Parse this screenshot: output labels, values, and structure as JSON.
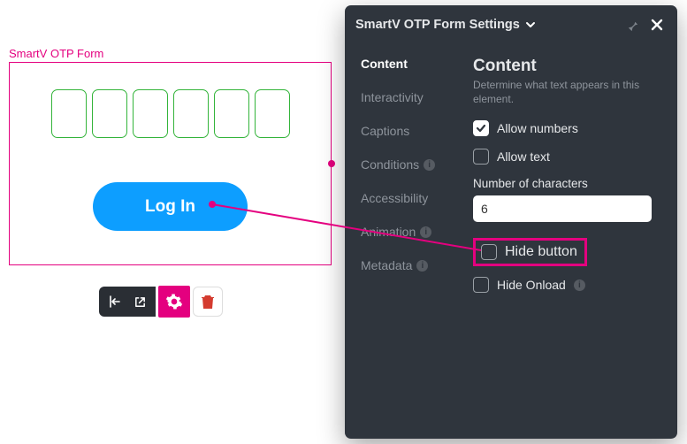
{
  "form": {
    "label": "SmartV OTP Form",
    "otp_cells": 6,
    "login_label": "Log In"
  },
  "toolbar": {
    "reset_icon": "reset",
    "open_icon": "open",
    "gear_icon": "settings",
    "trash_icon": "delete"
  },
  "panel": {
    "title": "SmartV OTP Form Settings",
    "tabs": {
      "content": "Content",
      "interactivity": "Interactivity",
      "captions": "Captions",
      "conditions": "Conditions",
      "accessibility": "Accessibility",
      "animation": "Animation",
      "metadata": "Metadata"
    },
    "content": {
      "heading": "Content",
      "description": "Determine what text appears in this element.",
      "allow_numbers": "Allow numbers",
      "allow_text": "Allow text",
      "num_chars_label": "Number of characters",
      "num_chars_value": "6",
      "hide_button": "Hide button",
      "hide_onload": "Hide Onload"
    }
  }
}
